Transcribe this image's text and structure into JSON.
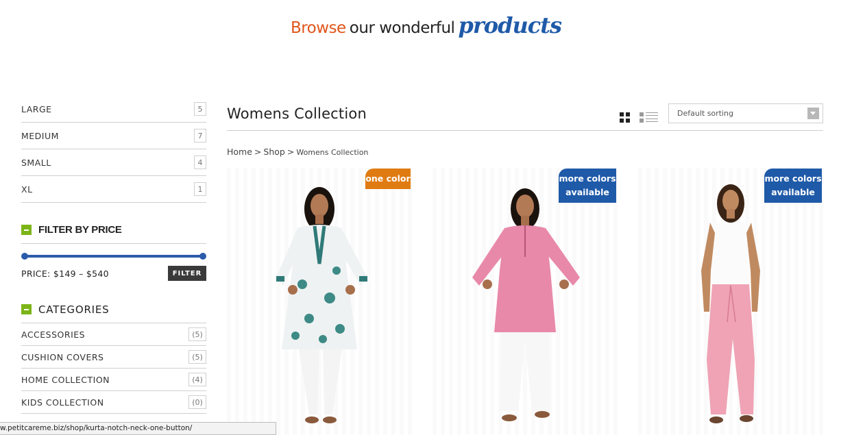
{
  "header": {
    "browse": "Browse",
    "middle": "our wonderful",
    "script": "products"
  },
  "sidebar": {
    "sizes": [
      {
        "label": "LARGE",
        "count": "5"
      },
      {
        "label": "MEDIUM",
        "count": "7"
      },
      {
        "label": "SMALL",
        "count": "4"
      },
      {
        "label": "XL",
        "count": "1"
      }
    ],
    "price_filter": {
      "title": "FILTER BY PRICE",
      "price_text": "PRICE: $149 – $540",
      "button": "FILTER",
      "min": 149,
      "max": 540
    },
    "categories": {
      "title": "CATEGORIES",
      "items": [
        {
          "label": "ACCESSORIES",
          "count": "(5)"
        },
        {
          "label": "CUSHION COVERS",
          "count": "(5)"
        },
        {
          "label": "HOME COLLECTION",
          "count": "(4)"
        },
        {
          "label": "KIDS COLLECTION",
          "count": "(0)"
        }
      ]
    }
  },
  "main": {
    "title": "Womens Collection",
    "sorting": "Default sorting",
    "breadcrumb": {
      "home": "Home",
      "shop": "Shop",
      "current": "Womens Collection",
      "separator": ">"
    },
    "products": [
      {
        "badge_line1": "one color",
        "badge_line2": "",
        "badge_color": "#e07b12"
      },
      {
        "badge_line1": "more colors",
        "badge_line2": "available",
        "badge_color": "#1f5aa8"
      },
      {
        "badge_line1": "more colors",
        "badge_line2": "available",
        "badge_color": "#1f5aa8"
      }
    ]
  },
  "statusbar": {
    "url": "w.petitcareme.biz/shop/kurta-notch-neck-one-button/"
  },
  "colors": {
    "accent_orange": "#e0561b",
    "accent_blue": "#1f5aa8",
    "widget_green": "#7cb518",
    "slider_blue": "#2b5bab"
  },
  "icons": {
    "grid_view": "grid-view-icon",
    "list_view": "list-view-icon",
    "sort_arrow": "chevron-down-icon",
    "widget_toggle": "minus-icon"
  }
}
